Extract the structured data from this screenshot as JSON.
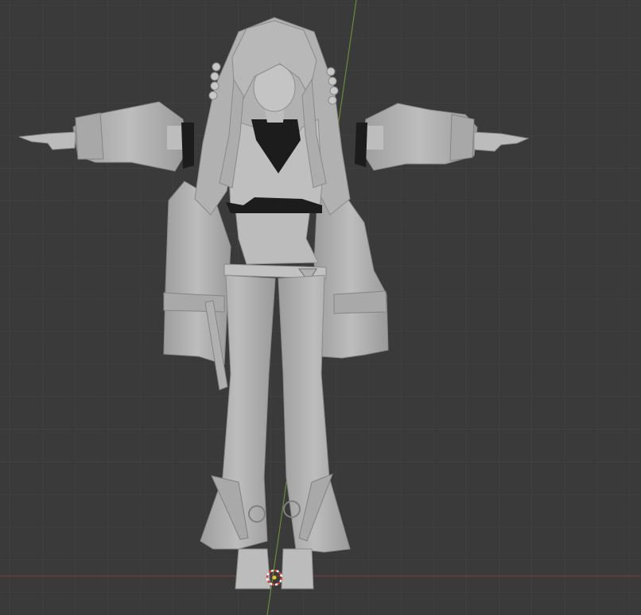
{
  "viewport": {
    "background_color": "#3a3a3a",
    "grid_color": "#444444",
    "y_axis_color": "#6b8a3a",
    "x_axis_color": "#7a3a3a",
    "model_color": "#b7b7b7",
    "model_shadow_color": "#8e8e8e",
    "model_dark_color": "#1c1c1c",
    "cursor_ring_colors": [
      "#e0403a",
      "#f2f2f2"
    ],
    "cursor_center_color": "#e8c23a",
    "icons": [
      "3d-cursor-icon"
    ]
  }
}
